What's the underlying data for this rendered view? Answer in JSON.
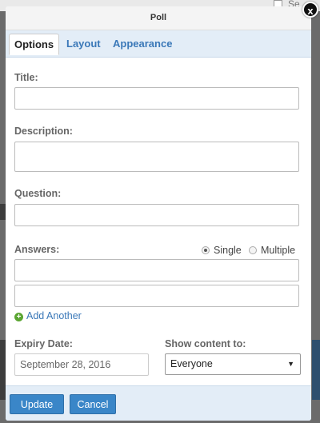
{
  "background": {
    "top_text": "Se"
  },
  "dialog": {
    "title": "Poll",
    "close_glyph": "x"
  },
  "tabs": [
    {
      "label": "Options",
      "active": true
    },
    {
      "label": "Layout",
      "active": false
    },
    {
      "label": "Appearance",
      "active": false
    }
  ],
  "form": {
    "title_label": "Title:",
    "title_value": "",
    "description_label": "Description:",
    "description_value": "",
    "question_label": "Question:",
    "question_value": "",
    "answers_label": "Answers:",
    "answer_type": {
      "single_label": "Single",
      "multiple_label": "Multiple",
      "selected": "single"
    },
    "answers": [
      "",
      ""
    ],
    "add_another_label": "Add Another",
    "expiry_label": "Expiry Date:",
    "expiry_value": "September 28, 2016",
    "show_content_label": "Show content to:",
    "show_content_value": "Everyone"
  },
  "footer": {
    "update_label": "Update",
    "cancel_label": "Cancel"
  },
  "colors": {
    "accent": "#3a86c8",
    "link": "#3a78b8",
    "tab_bar": "#e3edf7",
    "add_icon": "#5aa531"
  },
  "icons": {
    "close": "close-icon",
    "add": "plus-circle-icon",
    "dropdown": "chevron-down-icon"
  }
}
